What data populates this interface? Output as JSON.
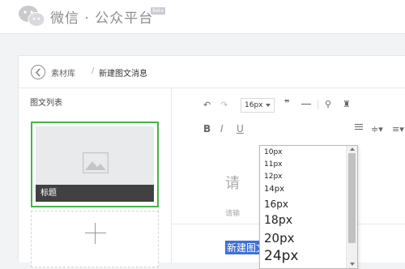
{
  "header": {
    "logo_text": "微信 · 公众平台",
    "badge": "Beta"
  },
  "breadcrumb": {
    "items": [
      "素材库",
      "新建图文消息"
    ],
    "separator": "/"
  },
  "sidebar": {
    "title": "图文列表",
    "cards": [
      {
        "caption": "标题"
      }
    ]
  },
  "toolbar": {
    "font_size": "16px",
    "bold": "B",
    "italic": "I",
    "underline": "U"
  },
  "font_size_options": [
    "10px",
    "11px",
    "12px",
    "14px",
    "16px",
    "18px",
    "20px",
    "24px"
  ],
  "editor": {
    "title_placeholder": "请",
    "author_placeholder": "请输",
    "selected_text": "新建图文"
  },
  "colors": {
    "accent_green": "#44b549",
    "selection_blue": "#3f71d6"
  }
}
